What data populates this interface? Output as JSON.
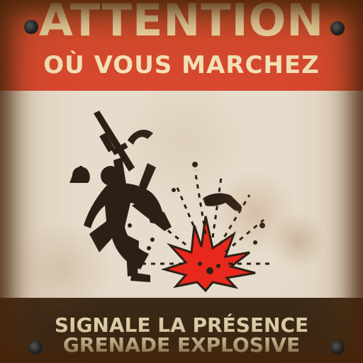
{
  "sign": {
    "title": "ATTENTION",
    "subtitle": "OÙ VOUS MARCHEZ",
    "line1": "SIGNALE LA PRÉSENCE",
    "line2": "GRENADE EXPLOSIVE"
  },
  "colors": {
    "banner_red": "#d8482e",
    "title_cream": "#efd9a6",
    "paper": "#e6dccb",
    "silhouette": "#2c2016",
    "explosion_red": "#e8281c",
    "rust_border": "#6a3a14"
  },
  "icons": [
    "soldier-with-rifle-icon",
    "explosion-icon",
    "helmet-icon",
    "boot-icon",
    "screw-icon"
  ]
}
